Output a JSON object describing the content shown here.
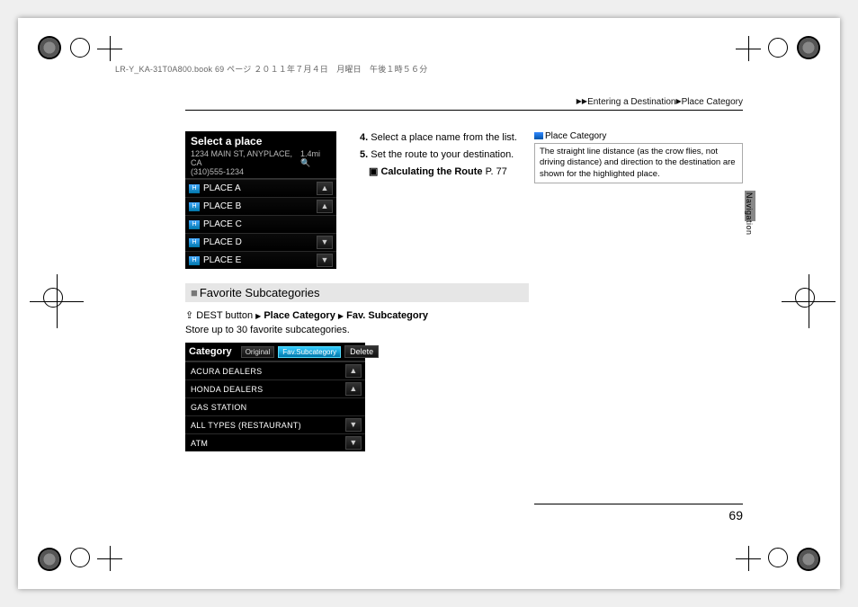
{
  "book_stamp": "LR-Y_KA-31T0A800.book  69 ページ  ２０１１年７月４日　月曜日　午後１時５６分",
  "breadcrumb": {
    "part1": "Entering a Destination",
    "part2": "Place Category"
  },
  "side_label": "Navigation",
  "page_number": "69",
  "screen1": {
    "title": "Select a place",
    "address": "1234 MAIN ST, ANYPLACE, CA",
    "phone": "(310)555-1234",
    "distance": "1.4mi",
    "places": [
      "PLACE A",
      "PLACE B",
      "PLACE C",
      "PLACE D",
      "PLACE E"
    ]
  },
  "steps": {
    "s4_num": "4.",
    "s4": "Select a place name from the list.",
    "s5_num": "5.",
    "s5": "Set the route to your destination.",
    "ref_label": "Calculating the Route",
    "ref_page": "P. 77"
  },
  "sidebox": {
    "title": "Place Category",
    "body": "The straight line distance (as the crow flies, not driving distance) and direction to the destination are shown for the highlighted place."
  },
  "subhead": "Favorite Subcategories",
  "navline": {
    "prefix": "DEST button",
    "step1": "Place Category",
    "step2": "Fav. Subcategory"
  },
  "store_text": "Store up to 30 favorite subcategories.",
  "screen2": {
    "heading": "Category",
    "tab_original": "Original",
    "tab_fav": "Fav.Subcategory",
    "delete": "Delete",
    "items": [
      "ACURA DEALERS",
      "HONDA DEALERS",
      "GAS STATION",
      "ALL TYPES (RESTAURANT)",
      "ATM"
    ]
  }
}
